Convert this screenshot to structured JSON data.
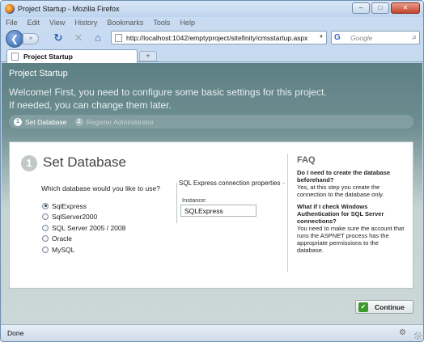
{
  "window": {
    "title": "Project Startup - Mozilla Firefox",
    "minimize": "–",
    "maximize": "□",
    "close": "✕"
  },
  "menu": [
    "File",
    "Edit",
    "View",
    "History",
    "Bookmarks",
    "Tools",
    "Help"
  ],
  "nav": {
    "back": "❮",
    "forward": "▾",
    "reload": "↻",
    "stop": "✕",
    "home": "⌂",
    "url": "http://localhost:1042/emptyproject/sitefinity/cmsstartup.aspx",
    "search_logo": "G",
    "search_placeholder": "Google",
    "search_icon": "⌕"
  },
  "tabs": [
    {
      "label": "Project Startup",
      "active": true
    }
  ],
  "new_tab": "+",
  "page": {
    "header_title": "Project Startup",
    "welcome": "Welcome! First, you need to configure some basic settings for this project. If needed, you can change them later.",
    "steps": [
      {
        "num": "1",
        "label": "Set Database",
        "active": true
      },
      {
        "num": "2",
        "label": "Register Administrator",
        "active": false
      }
    ],
    "section_num": "1",
    "section_title": "Set Database",
    "question": "Which database would you like to use?",
    "options": [
      {
        "label": "SqlExpress",
        "checked": true
      },
      {
        "label": "SqlServer2000",
        "checked": false
      },
      {
        "label": "SQL Server 2005 / 2008",
        "checked": false
      },
      {
        "label": "Oracle",
        "checked": false
      },
      {
        "label": "MySQL",
        "checked": false
      }
    ],
    "connection_legend": "SQL Express connection properties",
    "instance_label": "Instance:",
    "instance_value": "SQLExpress",
    "faq": {
      "title": "FAQ",
      "items": [
        {
          "q": "Do I need to create the database beforehand?",
          "a": "Yes, at this step you create the connection to the database only."
        },
        {
          "q": "What if I check Windows Authentication for SQL Server connections?",
          "a": "You need to make sure the account that runs the ASPNET process has the appropriate permissions to the database."
        }
      ]
    },
    "continue_label": "Continue",
    "continue_icon": "✔"
  },
  "status": {
    "text": "Done",
    "icon": "⚙"
  },
  "colors": {
    "header_bg": "#5d8084",
    "panel_bg": "#ffffff",
    "chrome_bg": "#c9dcf2",
    "continue_check": "#3c9a2c"
  }
}
